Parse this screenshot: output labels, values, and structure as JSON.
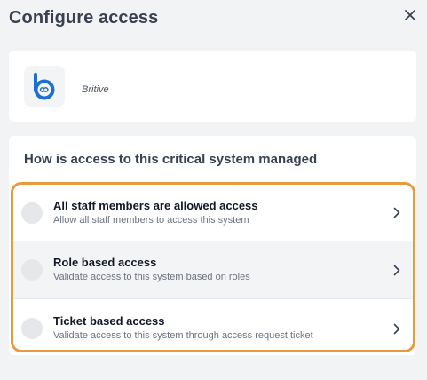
{
  "dialog": {
    "title": "Configure access"
  },
  "app": {
    "name": "Britive",
    "icon": "britive-logo"
  },
  "question": {
    "title": "How is access to this critical system managed",
    "options": [
      {
        "title": "All staff members are allowed access",
        "description": "Allow all staff members to access this system"
      },
      {
        "title": "Role based access",
        "description": "Validate access to this system based on roles"
      },
      {
        "title": "Ticket based access",
        "description": "Validate access to this system through access request ticket"
      }
    ]
  },
  "colors": {
    "highlight_border": "#e89a3c",
    "brand_blue": "#1f6fd1"
  }
}
